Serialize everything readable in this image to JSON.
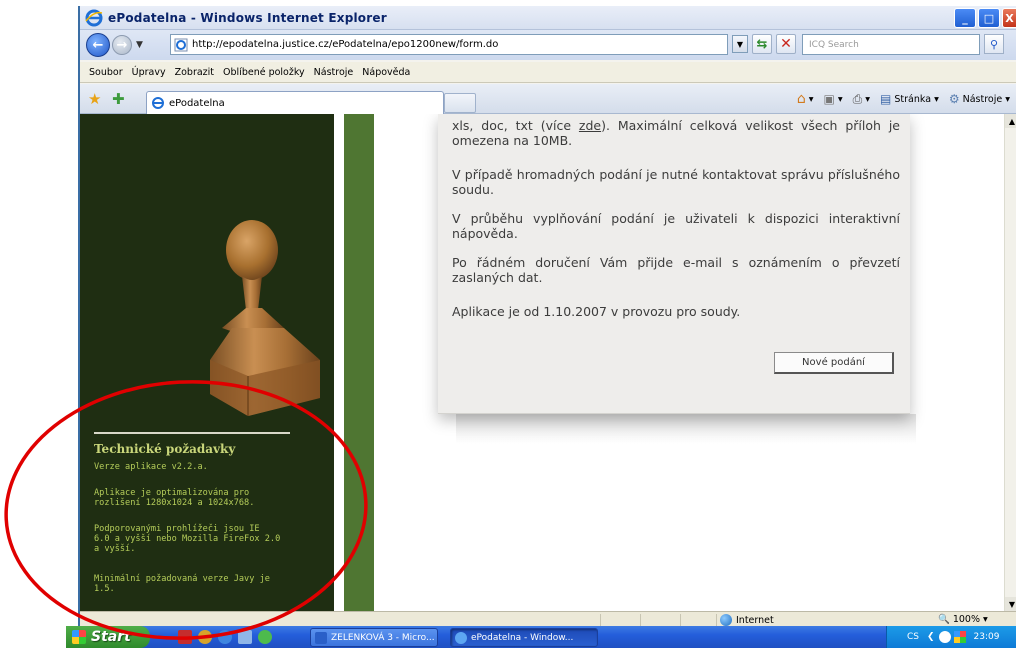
{
  "window": {
    "title": "ePodatelna - Windows Internet Explorer",
    "min": "_",
    "max": "□",
    "close": "X"
  },
  "address": {
    "url": "http://epodatelna.justice.cz/ePodatelna/epo1200new/form.do",
    "search_placeholder": "ICQ Search"
  },
  "menu": [
    "Soubor",
    "Úpravy",
    "Zobrazit",
    "Oblíbené položky",
    "Nástroje",
    "Nápověda"
  ],
  "tab": {
    "label": "ePodatelna"
  },
  "commandbar": {
    "page": "Stránka",
    "tools": "Nástroje"
  },
  "page": {
    "paragraph1": "xls, doc, txt (více zde). Maximální celková velikost všech příloh je omezena na 10MB.",
    "paragraph1_link": "zde",
    "paragraph2": "V případě hromadných podání je nutné kontaktovat správu příslušného soudu.",
    "paragraph3": "V průběhu vyplňování podání je uživateli k dispozici interaktivní nápověda.",
    "paragraph4": "Po řádném doručení Vám přijde e-mail s oznámením o převzetí zaslaných dat.",
    "paragraph5": "Aplikace je od 1.10.2007 v provozu pro soudy.",
    "new_button": "Nové podání"
  },
  "sidebar": {
    "title": "Technické požadavky",
    "version": "Verze aplikace v2.2.a.",
    "resolution_1": "Aplikace je optimalizována pro",
    "resolution_2": "rozlišení 1280x1024 a 1024x768.",
    "browsers_1": "Podporovanými prohlížeči jsou IE",
    "browsers_2": "6.0 a vyšší nebo Mozilla FireFox 2.0",
    "browsers_3": "a vyšší.",
    "java_1": "Minimální požadovaná verze Javy je",
    "java_2": "1.5."
  },
  "status": {
    "zone": "Internet",
    "zoom": "100%"
  },
  "taskbar": {
    "start": "Start",
    "item1": "ZELENKOVÁ 3 - Micro...",
    "item2": "ePodatelna - Window...",
    "lang": "CS",
    "time": "23:09"
  },
  "colors": {
    "sidebar_bg": "#1f2e12",
    "sidebar_text": "#b5cd5a",
    "stripe": "#4f7632",
    "annotation": "#e00000"
  }
}
